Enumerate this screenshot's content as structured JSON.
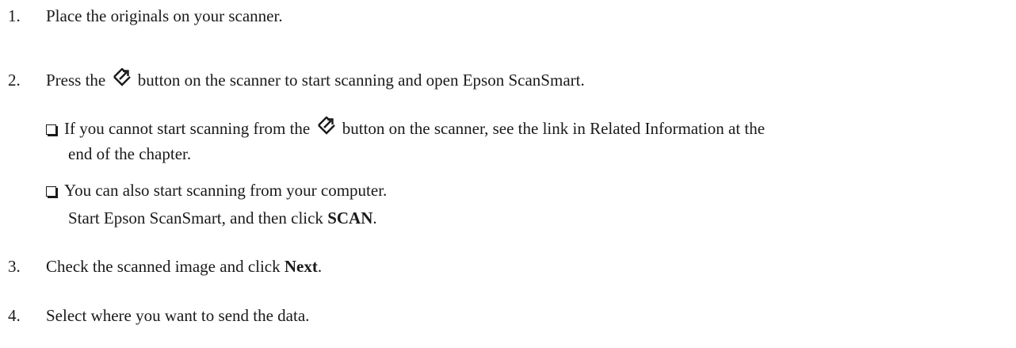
{
  "steps": [
    {
      "number": "1.",
      "text": "Place the originals on your scanner."
    },
    {
      "number": "2.",
      "text_before": "Press the",
      "text_after": "button on the scanner to start scanning and open Epson ScanSmart."
    },
    {
      "number": "3.",
      "text": "Check the scanned image and click",
      "bold": "Next",
      "text_end": "."
    },
    {
      "number": "4.",
      "text": "Select where you want to send the data."
    }
  ],
  "notes": [
    {
      "text_before": "If you cannot start scanning from the",
      "text_after": "button on the scanner, see the link in Related Information at the",
      "continuation": "end of the chapter."
    },
    {
      "text": "You can also start scanning from your computer.",
      "line2_before": "Start Epson ScanSmart, and then click",
      "line2_bold": "SCAN",
      "line2_end": "."
    }
  ],
  "icons": {
    "start_button": "scan-start-icon"
  }
}
